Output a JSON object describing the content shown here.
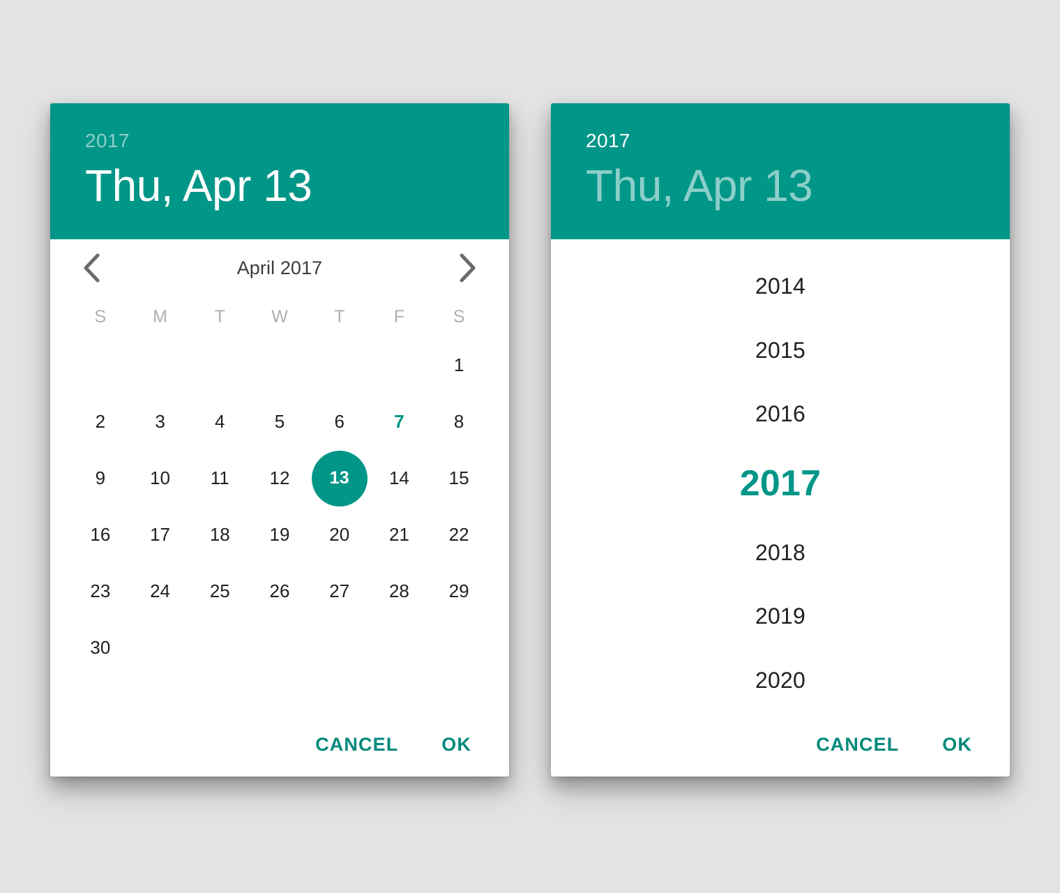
{
  "theme": {
    "accent": "#009688",
    "accent_button": "#00897b",
    "page_background": "#e3e3e3",
    "surface": "#ffffff",
    "text_primary": "#212121",
    "text_muted": "#b0b0b0"
  },
  "calendar_dialog": {
    "name": "date-picker-calendar-view",
    "header": {
      "year": "2017",
      "date": "Thu, Apr 13",
      "year_state": "inactive",
      "date_state": "active"
    },
    "nav": {
      "prev_icon": "chevron-left-icon",
      "next_icon": "chevron-right-icon",
      "month_label": "April 2017"
    },
    "weekdays": [
      "S",
      "M",
      "T",
      "W",
      "T",
      "F",
      "S"
    ],
    "leading_blanks": 6,
    "days": [
      1,
      2,
      3,
      4,
      5,
      6,
      7,
      8,
      9,
      10,
      11,
      12,
      13,
      14,
      15,
      16,
      17,
      18,
      19,
      20,
      21,
      22,
      23,
      24,
      25,
      26,
      27,
      28,
      29,
      30
    ],
    "today": 7,
    "selected_day": 13,
    "actions": {
      "cancel_label": "CANCEL",
      "ok_label": "OK"
    }
  },
  "year_dialog": {
    "name": "date-picker-year-view",
    "header": {
      "year": "2017",
      "date": "Thu, Apr 13",
      "year_state": "active",
      "date_state": "inactive"
    },
    "years": [
      "2014",
      "2015",
      "2016",
      "2017",
      "2018",
      "2019",
      "2020"
    ],
    "selected_year": "2017",
    "actions": {
      "cancel_label": "CANCEL",
      "ok_label": "OK"
    }
  }
}
